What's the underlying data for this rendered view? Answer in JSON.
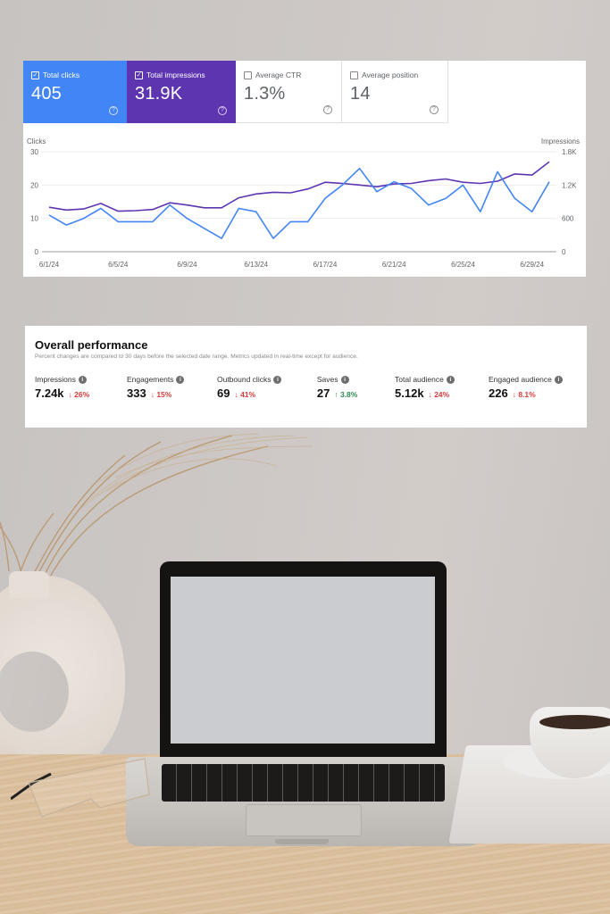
{
  "search_console": {
    "cards": [
      {
        "label": "Total clicks",
        "value": "405",
        "checked": true,
        "color": "#4285f4"
      },
      {
        "label": "Total impressions",
        "value": "31.9K",
        "checked": true,
        "color": "#5e35b1"
      },
      {
        "label": "Average CTR",
        "value": "1.3%",
        "checked": false,
        "color": "#ffffff"
      },
      {
        "label": "Average position",
        "value": "14",
        "checked": false,
        "color": "#ffffff"
      }
    ],
    "check_icon": "✓",
    "help_icon": "?"
  },
  "chart_data": {
    "type": "line",
    "title": "",
    "x": [
      "6/1/24",
      "6/2/24",
      "6/3/24",
      "6/4/24",
      "6/5/24",
      "6/6/24",
      "6/7/24",
      "6/8/24",
      "6/9/24",
      "6/10/24",
      "6/11/24",
      "6/12/24",
      "6/13/24",
      "6/14/24",
      "6/15/24",
      "6/16/24",
      "6/17/24",
      "6/18/24",
      "6/19/24",
      "6/20/24",
      "6/21/24",
      "6/22/24",
      "6/23/24",
      "6/24/24",
      "6/25/24",
      "6/26/24",
      "6/27/24",
      "6/28/24",
      "6/29/24",
      "6/30/24"
    ],
    "x_tick_labels": [
      "6/1/24",
      "6/5/24",
      "6/9/24",
      "6/13/24",
      "6/17/24",
      "6/21/24",
      "6/25/24",
      "6/29/24"
    ],
    "series": [
      {
        "name": "Clicks",
        "axis": "left",
        "color": "#4285f4",
        "values": [
          11,
          8,
          10,
          13,
          9,
          9,
          9,
          14,
          10,
          7,
          4,
          13,
          12,
          4,
          9,
          9,
          16,
          20,
          25,
          18,
          21,
          19,
          14,
          16,
          20,
          12,
          24,
          16,
          12,
          21
        ]
      },
      {
        "name": "Impressions",
        "axis": "right",
        "color": "#5e35b1",
        "values": [
          800,
          750,
          770,
          870,
          730,
          740,
          760,
          880,
          840,
          790,
          790,
          970,
          1040,
          1070,
          1060,
          1130,
          1250,
          1230,
          1200,
          1170,
          1220,
          1230,
          1280,
          1310,
          1250,
          1230,
          1270,
          1400,
          1380,
          1620
        ]
      }
    ],
    "ylabel_left": "Clicks",
    "ylabel_right": "Impressions",
    "ylim_left": [
      0,
      30
    ],
    "ylim_right": [
      0,
      1800
    ],
    "yticks_left": [
      "0",
      "10",
      "20",
      "30"
    ],
    "yticks_right": [
      "0",
      "600",
      "1.2K",
      "1.8K"
    ],
    "grid": true,
    "legend": "none"
  },
  "performance": {
    "title": "Overall performance",
    "subtitle": "Percent changes are compared to 30 days before the selected date range. Metrics updated in real-time except for audience.",
    "info_icon": "i",
    "metrics": [
      {
        "label": "Impressions",
        "value": "7.24k",
        "change": "26%",
        "direction": "down",
        "arrow": "↓"
      },
      {
        "label": "Engagements",
        "value": "333",
        "change": "15%",
        "direction": "down",
        "arrow": "↓"
      },
      {
        "label": "Outbound clicks",
        "value": "69",
        "change": "41%",
        "direction": "down",
        "arrow": "↓"
      },
      {
        "label": "Saves",
        "value": "27",
        "change": "3.8%",
        "direction": "up",
        "arrow": "↑"
      },
      {
        "label": "Total audience",
        "value": "5.12k",
        "change": "24%",
        "direction": "down",
        "arrow": "↓"
      },
      {
        "label": "Engaged audience",
        "value": "226",
        "change": "8.1%",
        "direction": "down",
        "arrow": "↓"
      }
    ]
  }
}
